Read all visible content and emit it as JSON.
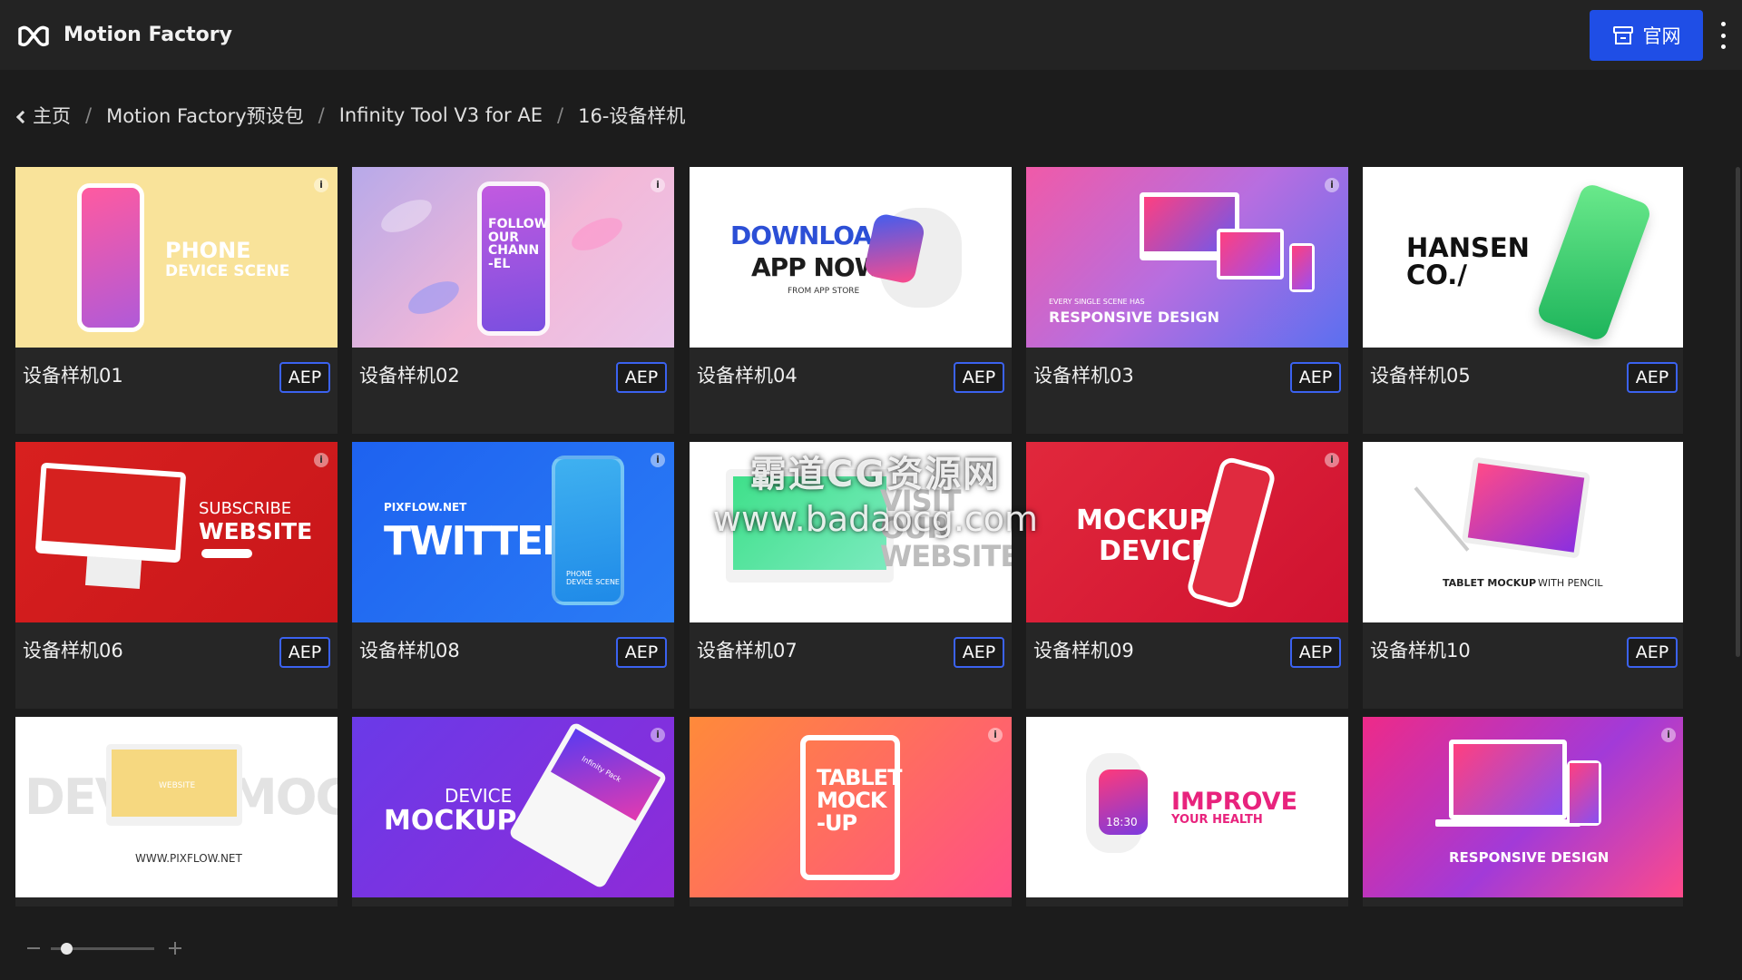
{
  "app": {
    "name": "Motion Factory",
    "logo_icon": "motion-factory-logo-icon"
  },
  "header": {
    "site_button_label": "官网",
    "site_button_icon": "store-icon",
    "menu_icon": "more-vertical-icon",
    "accent": "#1f4ee6"
  },
  "breadcrumb": {
    "back_icon": "chevron-left-icon",
    "items": [
      "主页",
      "Motion Factory预设包",
      "Infinity Tool V3 for AE",
      "16-设备样机"
    ]
  },
  "badge_label": "AEP",
  "cards": [
    {
      "title": "设备样机01",
      "thumb_text": "PHONE",
      "thumb_sub": "DEVICE SCENE",
      "thumb_small": "PHONE\nDEVICE SCENE"
    },
    {
      "title": "设备样机02",
      "thumb_text": "FOLLOW\nOUR\nCHANN\n-EL"
    },
    {
      "title": "设备样机04",
      "thumb_text": "DOWNLOAD",
      "thumb_sub": "APP NOW",
      "thumb_small": "FROM APP STORE"
    },
    {
      "title": "设备样机03",
      "thumb_small": "EVERY SINGLE SCENE HAS",
      "thumb_text": "RESPONSIVE DESIGN"
    },
    {
      "title": "设备样机05",
      "thumb_text": "HANSEN",
      "thumb_sub": "CO./"
    },
    {
      "title": "设备样机06",
      "thumb_text": "SUBSCRIBE",
      "thumb_sub": "WEBSITE"
    },
    {
      "title": "设备样机08",
      "thumb_small": "PIXFLOW.NET",
      "thumb_text": "TWITTER",
      "thumb_sub": "PHONE\nDEVICE SCENE"
    },
    {
      "title": "设备样机07",
      "thumb_text": "VISIT\nOUR\nWEBSITE"
    },
    {
      "title": "设备样机09",
      "thumb_text": "MOCKUP",
      "thumb_sub": "DEVICE"
    },
    {
      "title": "设备样机10",
      "thumb_text": "TABLET MOCKUP",
      "thumb_sub": "WITH PENCIL"
    },
    {
      "thumb_text": "DEVICE MOCKUP",
      "thumb_sub": "WWW.PIXFLOW.NET",
      "thumb_small": "WEBSITE"
    },
    {
      "thumb_small": "DEVICE",
      "thumb_text": "MOCKUP",
      "thumb_sub": "Infinity Pack"
    },
    {
      "thumb_text": "TABLET\nMOCK\n-UP"
    },
    {
      "thumb_small": "18:30",
      "thumb_text": "IMPROVE",
      "thumb_sub": "YOUR HEALTH"
    },
    {
      "thumb_text": "RESPONSIVE DESIGN"
    }
  ],
  "watermark": {
    "line1": "霸道CG资源网",
    "line2": "www.badaocg.com"
  },
  "zoom": {
    "level": 0.15,
    "minus_icon": "zoom-out-icon",
    "plus_icon": "zoom-in-icon"
  }
}
